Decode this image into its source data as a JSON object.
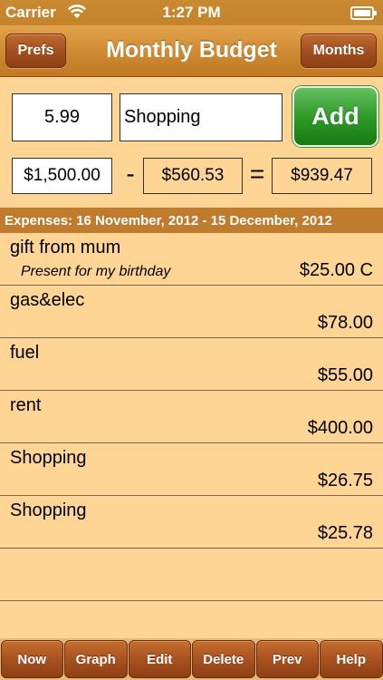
{
  "status": {
    "carrier": "Carrier",
    "time": "1:27 PM"
  },
  "nav": {
    "title": "Monthly Budget",
    "left_button": "Prefs",
    "right_button": "Months"
  },
  "entry": {
    "amount_value": "5.99",
    "description_value": "Shopping",
    "add_label": "Add"
  },
  "summary": {
    "budget": "$1,500.00",
    "minus": "-",
    "spent": "$560.53",
    "equals": "=",
    "remaining": "$939.47"
  },
  "section_header": "Expenses: 16 November, 2012 - 15 December, 2012",
  "expenses": [
    {
      "title": "gift from mum",
      "note": "Present for my birthday",
      "amount": "$25.00 C"
    },
    {
      "title": "gas&elec",
      "note": "",
      "amount": "$78.00"
    },
    {
      "title": "fuel",
      "note": "",
      "amount": "$55.00"
    },
    {
      "title": "rent",
      "note": "",
      "amount": "$400.00"
    },
    {
      "title": "Shopping",
      "note": "",
      "amount": "$26.75"
    },
    {
      "title": "Shopping",
      "note": "",
      "amount": "$25.78"
    }
  ],
  "toolbar": {
    "now": "Now",
    "graph": "Graph",
    "edit": "Edit",
    "delete": "Delete",
    "prev": "Prev",
    "help": "Help"
  },
  "colors": {
    "background": "#ffd596",
    "header_brown": "#c07c2c",
    "button_brown": "#a85221",
    "add_green": "#2f9a2a"
  },
  "icons": [
    "wifi-icon",
    "battery-icon"
  ]
}
